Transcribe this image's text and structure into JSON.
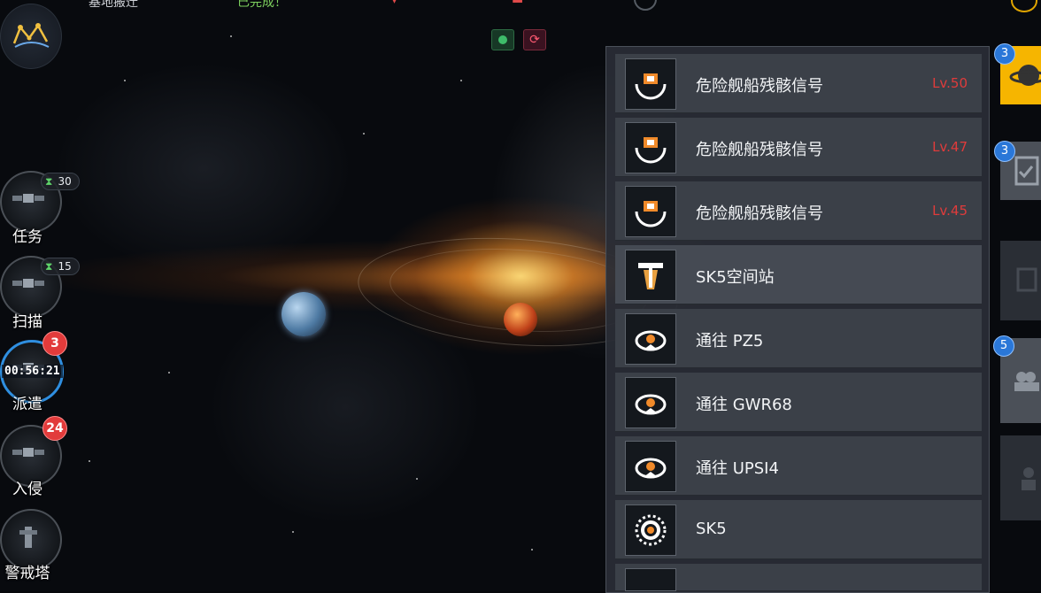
{
  "top_bar": {
    "items": [
      "基地搬迁",
      "已完成！"
    ],
    "accent_colors": {
      "done": "#7ed25f",
      "alert": "#e04a4a"
    }
  },
  "header_buttons": [
    {
      "icon": "green-indicator-icon"
    },
    {
      "icon": "refresh-red-icon",
      "glyph": "⟳"
    }
  ],
  "avatar": {
    "icon": "constellation-map-icon"
  },
  "left_menu": [
    {
      "label": "任务",
      "timer": "30",
      "badge": null,
      "countdown": null,
      "icon": "satellite-icon"
    },
    {
      "label": "扫描",
      "timer": "15",
      "badge": null,
      "countdown": null,
      "icon": "satellite-icon"
    },
    {
      "label": "派遣",
      "timer": null,
      "badge": "3",
      "countdown": "00:56:21",
      "icon": "satellite-icon"
    },
    {
      "label": "入侵",
      "timer": null,
      "badge": "24",
      "countdown": null,
      "icon": "satellite-icon"
    },
    {
      "label": "警戒塔",
      "timer": null,
      "badge": null,
      "countdown": null,
      "icon": "tower-icon"
    }
  ],
  "locations": [
    {
      "name": "危险舰船残骸信号",
      "level": "Lv.50",
      "icon": "wreck-signal-icon"
    },
    {
      "name": "危险舰船残骸信号",
      "level": "Lv.47",
      "icon": "wreck-signal-icon"
    },
    {
      "name": "危险舰船残骸信号",
      "level": "Lv.45",
      "icon": "wreck-signal-icon"
    },
    {
      "name": "SK5空间站",
      "level": "",
      "icon": "space-station-icon"
    },
    {
      "name": "通往 PZ5",
      "level": "",
      "icon": "stargate-icon"
    },
    {
      "name": "通往 GWR68",
      "level": "",
      "icon": "stargate-icon"
    },
    {
      "name": "通往 UPSI4",
      "level": "",
      "icon": "stargate-icon"
    },
    {
      "name": "SK5",
      "level": "",
      "icon": "sun-icon"
    }
  ],
  "right_tabs": [
    {
      "badge": "3",
      "icon": "planet-icon",
      "style": "yellow"
    },
    {
      "badge": "3",
      "icon": "checklist-icon",
      "style": "grey"
    },
    {
      "badge": null,
      "icon": "module-icon",
      "style": "dark"
    },
    {
      "badge": "5",
      "icon": "fleet-icon",
      "style": "grey"
    },
    {
      "badge": null,
      "icon": "pilot-icon",
      "style": "dark"
    }
  ]
}
